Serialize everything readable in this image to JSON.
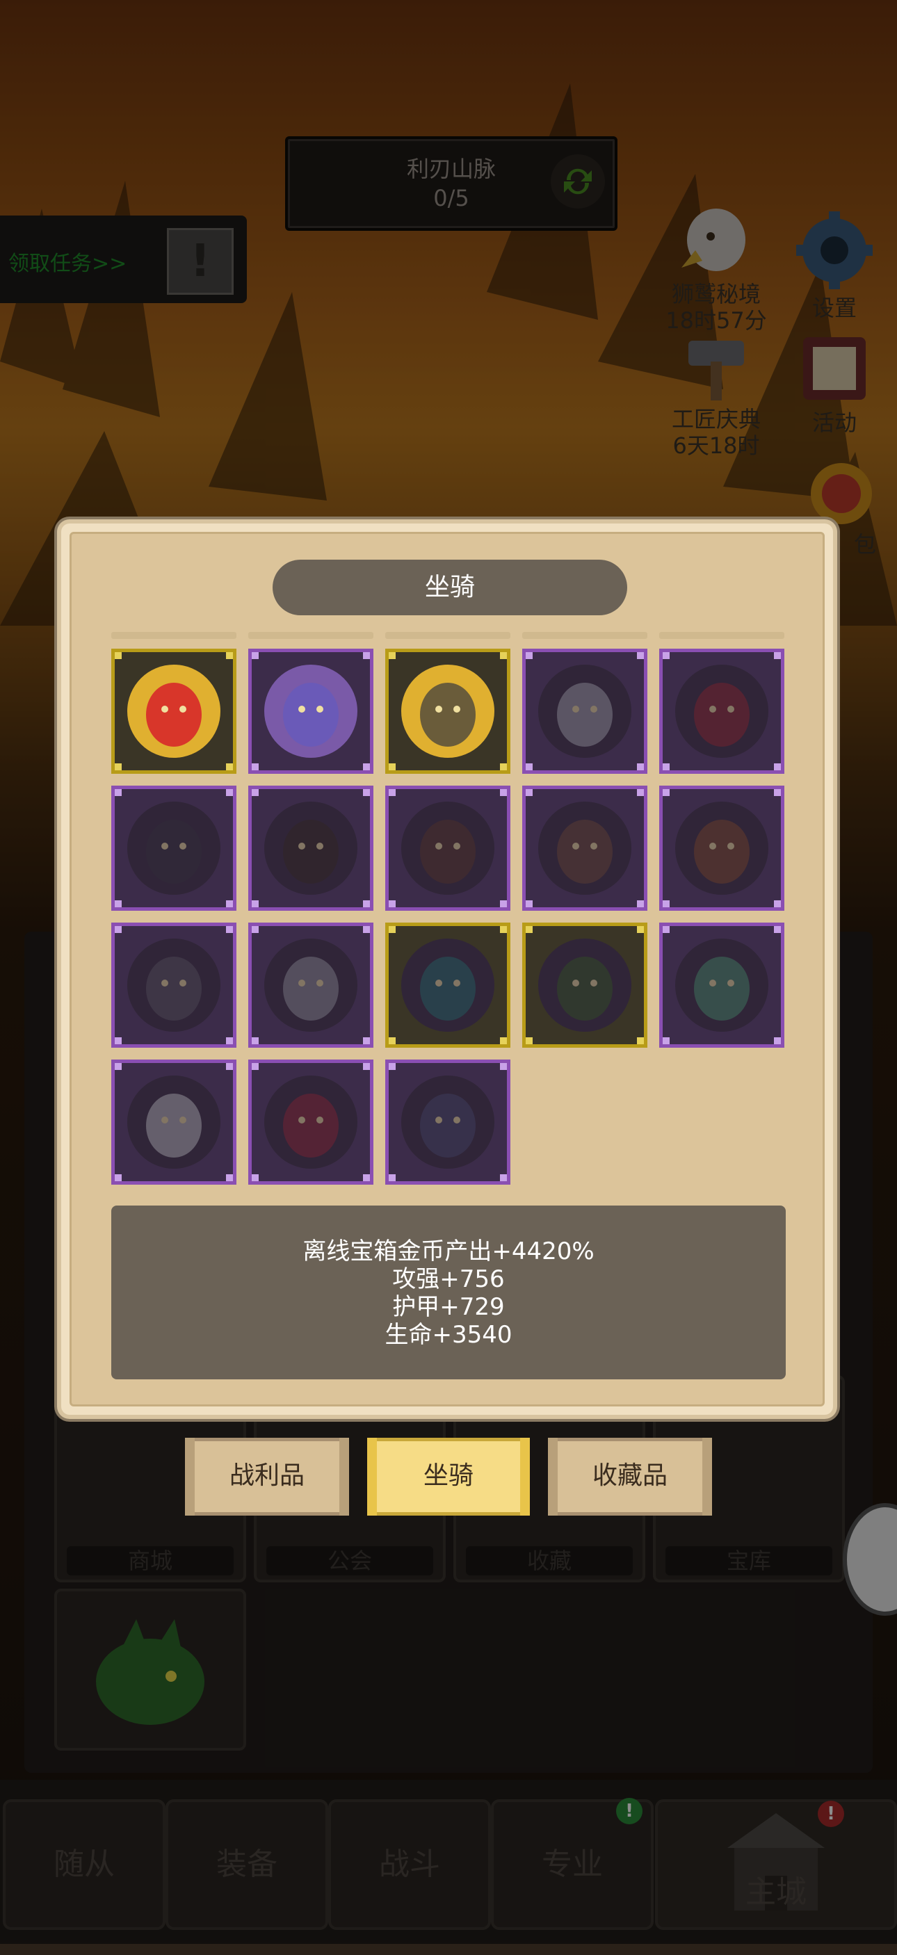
{
  "header": {
    "location_name": "利刃山脉",
    "location_progress": "0/5",
    "quest_button": "领取任务>>"
  },
  "side_icons": [
    {
      "name": "lion-realm",
      "label": "狮鹫秘境",
      "sub": "18时57分"
    },
    {
      "name": "settings",
      "label": "设置",
      "sub": ""
    },
    {
      "name": "craft-festival",
      "label": "工匠庆典",
      "sub": "6天18时"
    },
    {
      "name": "activity",
      "label": "活动",
      "sub": ""
    },
    {
      "name": "pack",
      "label": "包",
      "sub": ""
    }
  ],
  "dialog": {
    "title": "坐骑",
    "mounts": [
      {
        "rarity": "gold",
        "owned": true,
        "color": "#d8362a"
      },
      {
        "rarity": "purple",
        "owned": true,
        "color": "#6a5ab8"
      },
      {
        "rarity": "gold",
        "owned": true,
        "color": "#6a5c3a"
      },
      {
        "rarity": "purple",
        "owned": false,
        "color": "#9a9aa2"
      },
      {
        "rarity": "purple",
        "owned": false,
        "color": "#8a2a34"
      },
      {
        "rarity": "purple",
        "owned": false,
        "color": "#3a3640"
      },
      {
        "rarity": "purple",
        "owned": false,
        "color": "#3a3028"
      },
      {
        "rarity": "purple",
        "owned": false,
        "color": "#5a3a30"
      },
      {
        "rarity": "purple",
        "owned": false,
        "color": "#6a4a3a"
      },
      {
        "rarity": "purple",
        "owned": false,
        "color": "#7a4a30"
      },
      {
        "rarity": "purple",
        "owned": false,
        "color": "#5a5460"
      },
      {
        "rarity": "purple",
        "owned": false,
        "color": "#8a8a92"
      },
      {
        "rarity": "gold",
        "owned": false,
        "color": "#2a6a6a"
      },
      {
        "rarity": "gold",
        "owned": false,
        "color": "#3a5a2a"
      },
      {
        "rarity": "purple",
        "owned": false,
        "color": "#4a8a6a"
      },
      {
        "rarity": "purple",
        "owned": false,
        "color": "#b0b0b4"
      },
      {
        "rarity": "purple",
        "owned": false,
        "color": "#8a2a3a"
      },
      {
        "rarity": "purple",
        "owned": false,
        "color": "#4a4a6a"
      }
    ],
    "bonus_lines": [
      "离线宝箱金币产出+4420%",
      "攻强+756",
      "护甲+729",
      "生命+3540"
    ],
    "tabs": [
      "战利品",
      "坐骑",
      "收藏品"
    ],
    "active_tab": "坐骑"
  },
  "buildings": [
    {
      "label": "商城"
    },
    {
      "label": "公会"
    },
    {
      "label": "收藏"
    },
    {
      "label": "宝库"
    }
  ],
  "nav": [
    {
      "label": "随从",
      "badge": ""
    },
    {
      "label": "装备",
      "badge": ""
    },
    {
      "label": "战斗",
      "badge": ""
    },
    {
      "label": "专业",
      "badge": "!"
    },
    {
      "label": "主城",
      "badge": "!"
    }
  ],
  "colors": {
    "gold_frame": "#b89c18",
    "purple_frame": "#8a4fb2",
    "active_tab": "#f6dc86"
  }
}
